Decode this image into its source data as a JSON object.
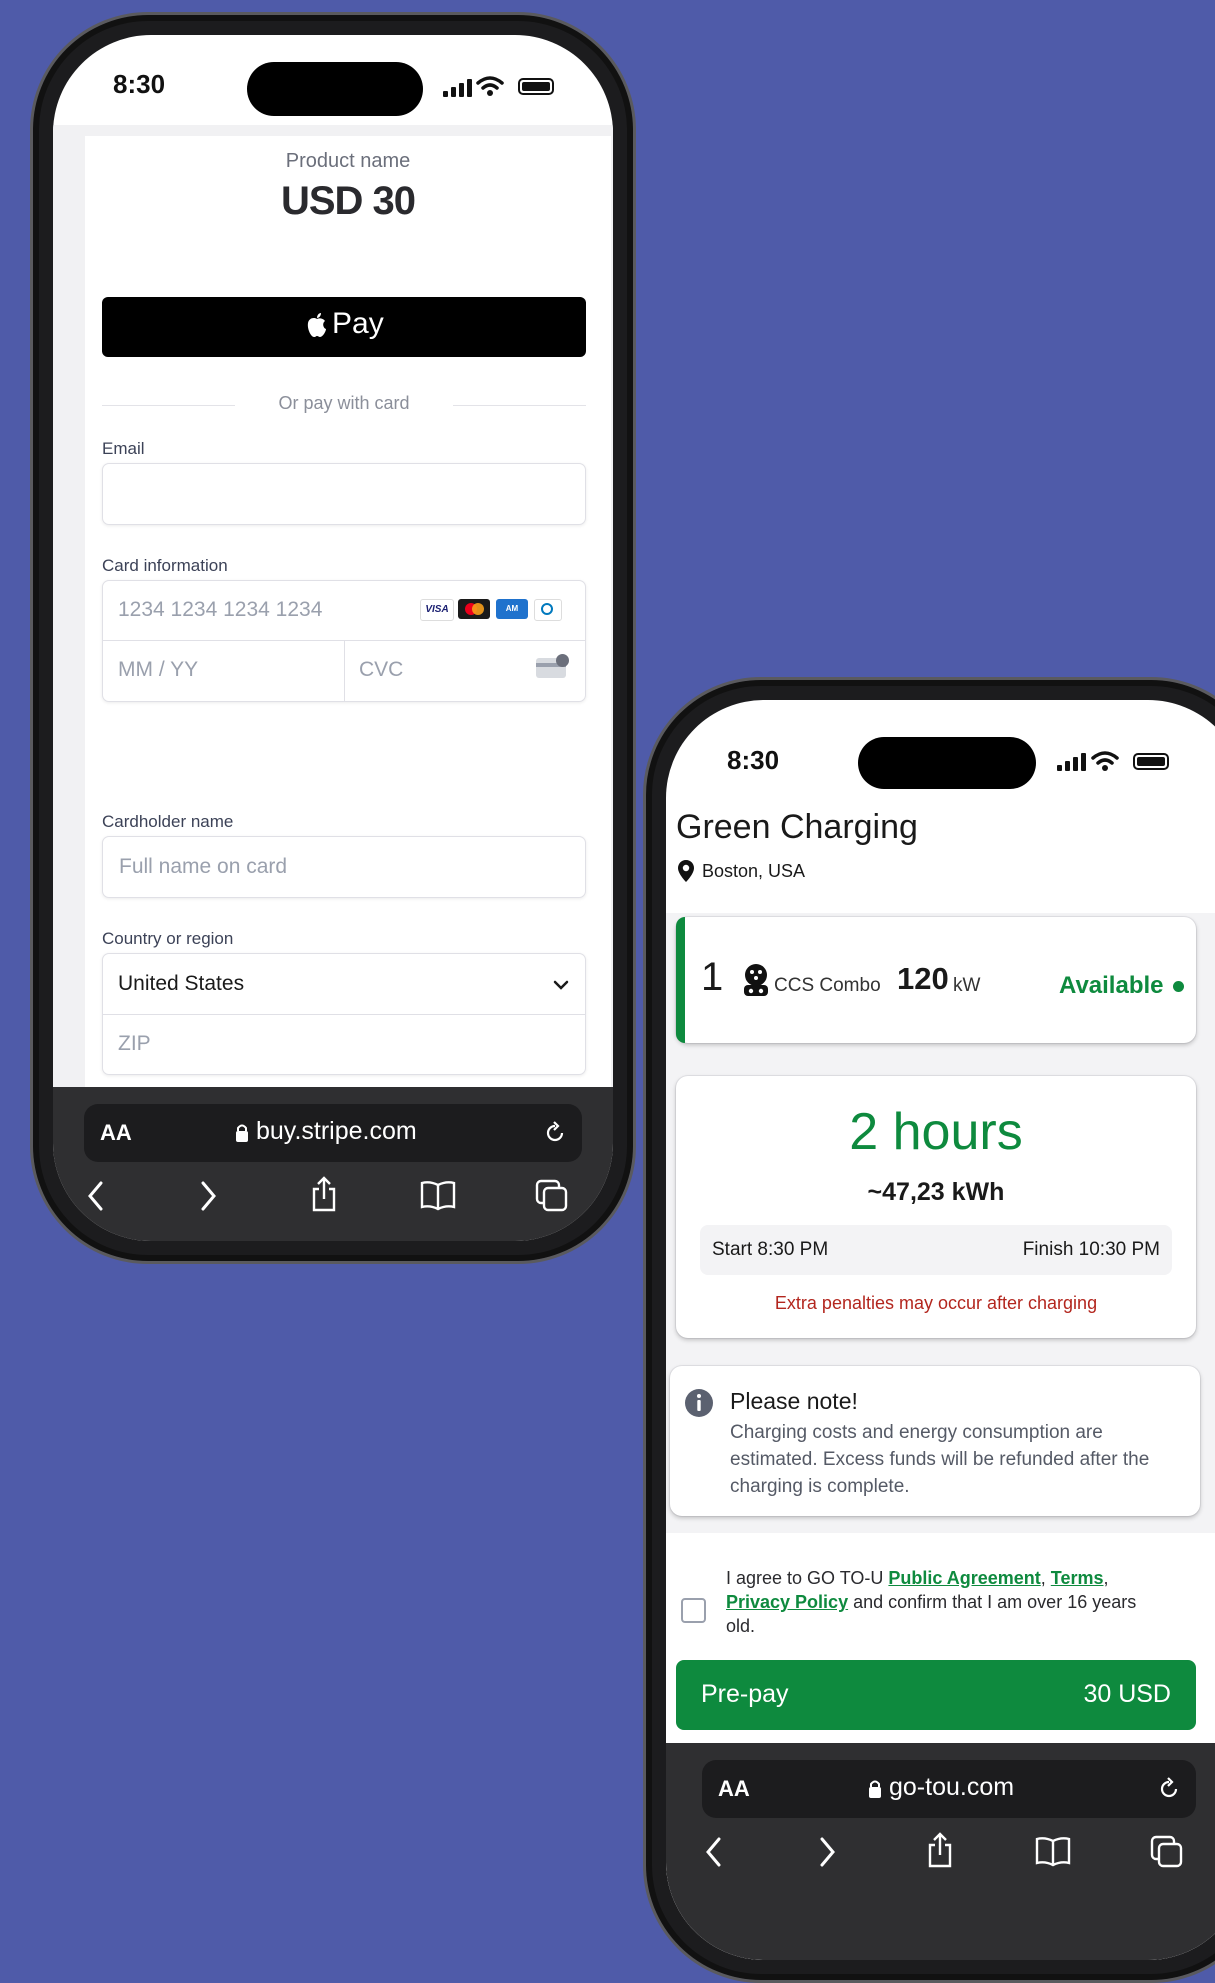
{
  "status_time": "8:30",
  "stripe": {
    "product_name": "Product name",
    "price": "USD 30",
    "apple_pay_label": "Pay",
    "divider_text": "Or pay with card",
    "email_label": "Email",
    "email_value": "",
    "card_label": "Card information",
    "card_number_placeholder": "1234 1234 1234 1234",
    "expiry_placeholder": "MM / YY",
    "cvc_placeholder": "CVC",
    "card_brands": [
      "VISA",
      "mastercard",
      "amex",
      "diners"
    ],
    "cardholder_label": "Cardholder name",
    "cardholder_placeholder": "Full name on card",
    "country_label": "Country or region",
    "country_value": "United States",
    "zip_placeholder": "ZIP"
  },
  "browser1": {
    "text_size": "AA",
    "url": "buy.stripe.com"
  },
  "charging": {
    "title": "Green Charging",
    "location": "Boston, USA",
    "connector": {
      "number": "1",
      "type": "CCS Combo",
      "power": "120",
      "unit": "kW",
      "status": "Available"
    },
    "duration": "2 hours",
    "energy": "~47,23 kWh",
    "start": "Start 8:30 PM",
    "finish": "Finish 10:30 PM",
    "penalty": "Extra penalties may occur after charging",
    "note_title": "Please note!",
    "note_text": "Charging costs and energy consumption are estimated. Excess funds will be refunded after the charging is complete.",
    "agree_pre": "I agree to GO TO-U ",
    "agree_link1": "Public Agreement",
    "agree_sep": ", ",
    "agree_link2": "Terms",
    "agree_sep2": ",",
    "agree_link3": "Privacy Policy",
    "agree_post": " and confirm that I am over 16 years old.",
    "prepay_label": "Pre-pay",
    "prepay_amount": "30 USD"
  },
  "browser2": {
    "text_size": "AA",
    "url": "go-tou.com"
  },
  "colors": {
    "background": "#4f5ba9",
    "accent_green": "#0e8a3e",
    "penalty_red": "#b3261e"
  }
}
